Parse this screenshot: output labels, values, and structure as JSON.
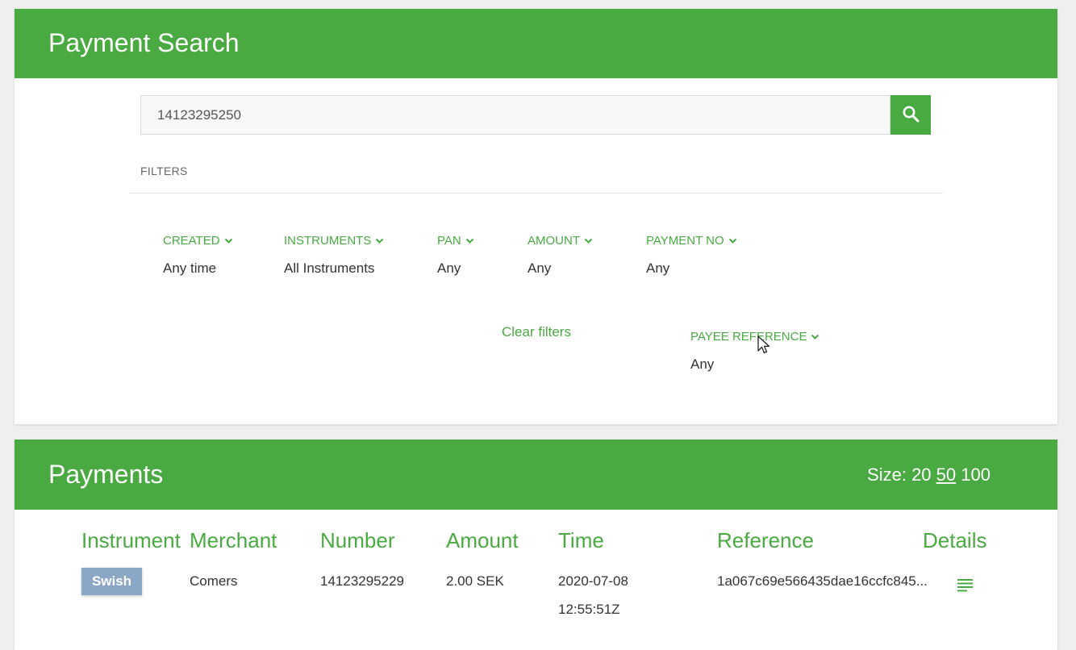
{
  "search_panel": {
    "title": "Payment Search",
    "query_value": "14123295250",
    "filters_label": "FILTERS",
    "filters": [
      {
        "label": "CREATED",
        "value": "Any time"
      },
      {
        "label": "INSTRUMENTS",
        "value": "All Instruments"
      },
      {
        "label": "PAN",
        "value": "Any"
      },
      {
        "label": "AMOUNT",
        "value": "Any"
      },
      {
        "label": "PAYMENT NO",
        "value": "Any"
      },
      {
        "label": "PAYEE REFERENCE",
        "value": "Any"
      }
    ],
    "clear_filters": "Clear filters"
  },
  "payments_panel": {
    "title": "Payments",
    "size": {
      "label": "Size:",
      "options": [
        "20",
        "50",
        "100"
      ],
      "selected": "50"
    },
    "columns": [
      "Instrument",
      "Merchant",
      "Number",
      "Amount",
      "Time",
      "Reference",
      "Details"
    ],
    "rows": [
      {
        "instrument": "Swish",
        "merchant": "Comers",
        "number": "14123295229",
        "amount": "2.00 SEK",
        "time_date": "2020-07-08",
        "time_clock": "12:55:51Z",
        "reference": "1a067c69e566435dae16ccfc845..."
      }
    ]
  },
  "icons": {
    "search": "search-icon",
    "chevron": "chevron-down-icon",
    "details": "details-lines-icon"
  },
  "colors": {
    "brand_green": "#4aaa42",
    "badge_swish": "#8aa8c6",
    "page_bg": "#efefef"
  }
}
